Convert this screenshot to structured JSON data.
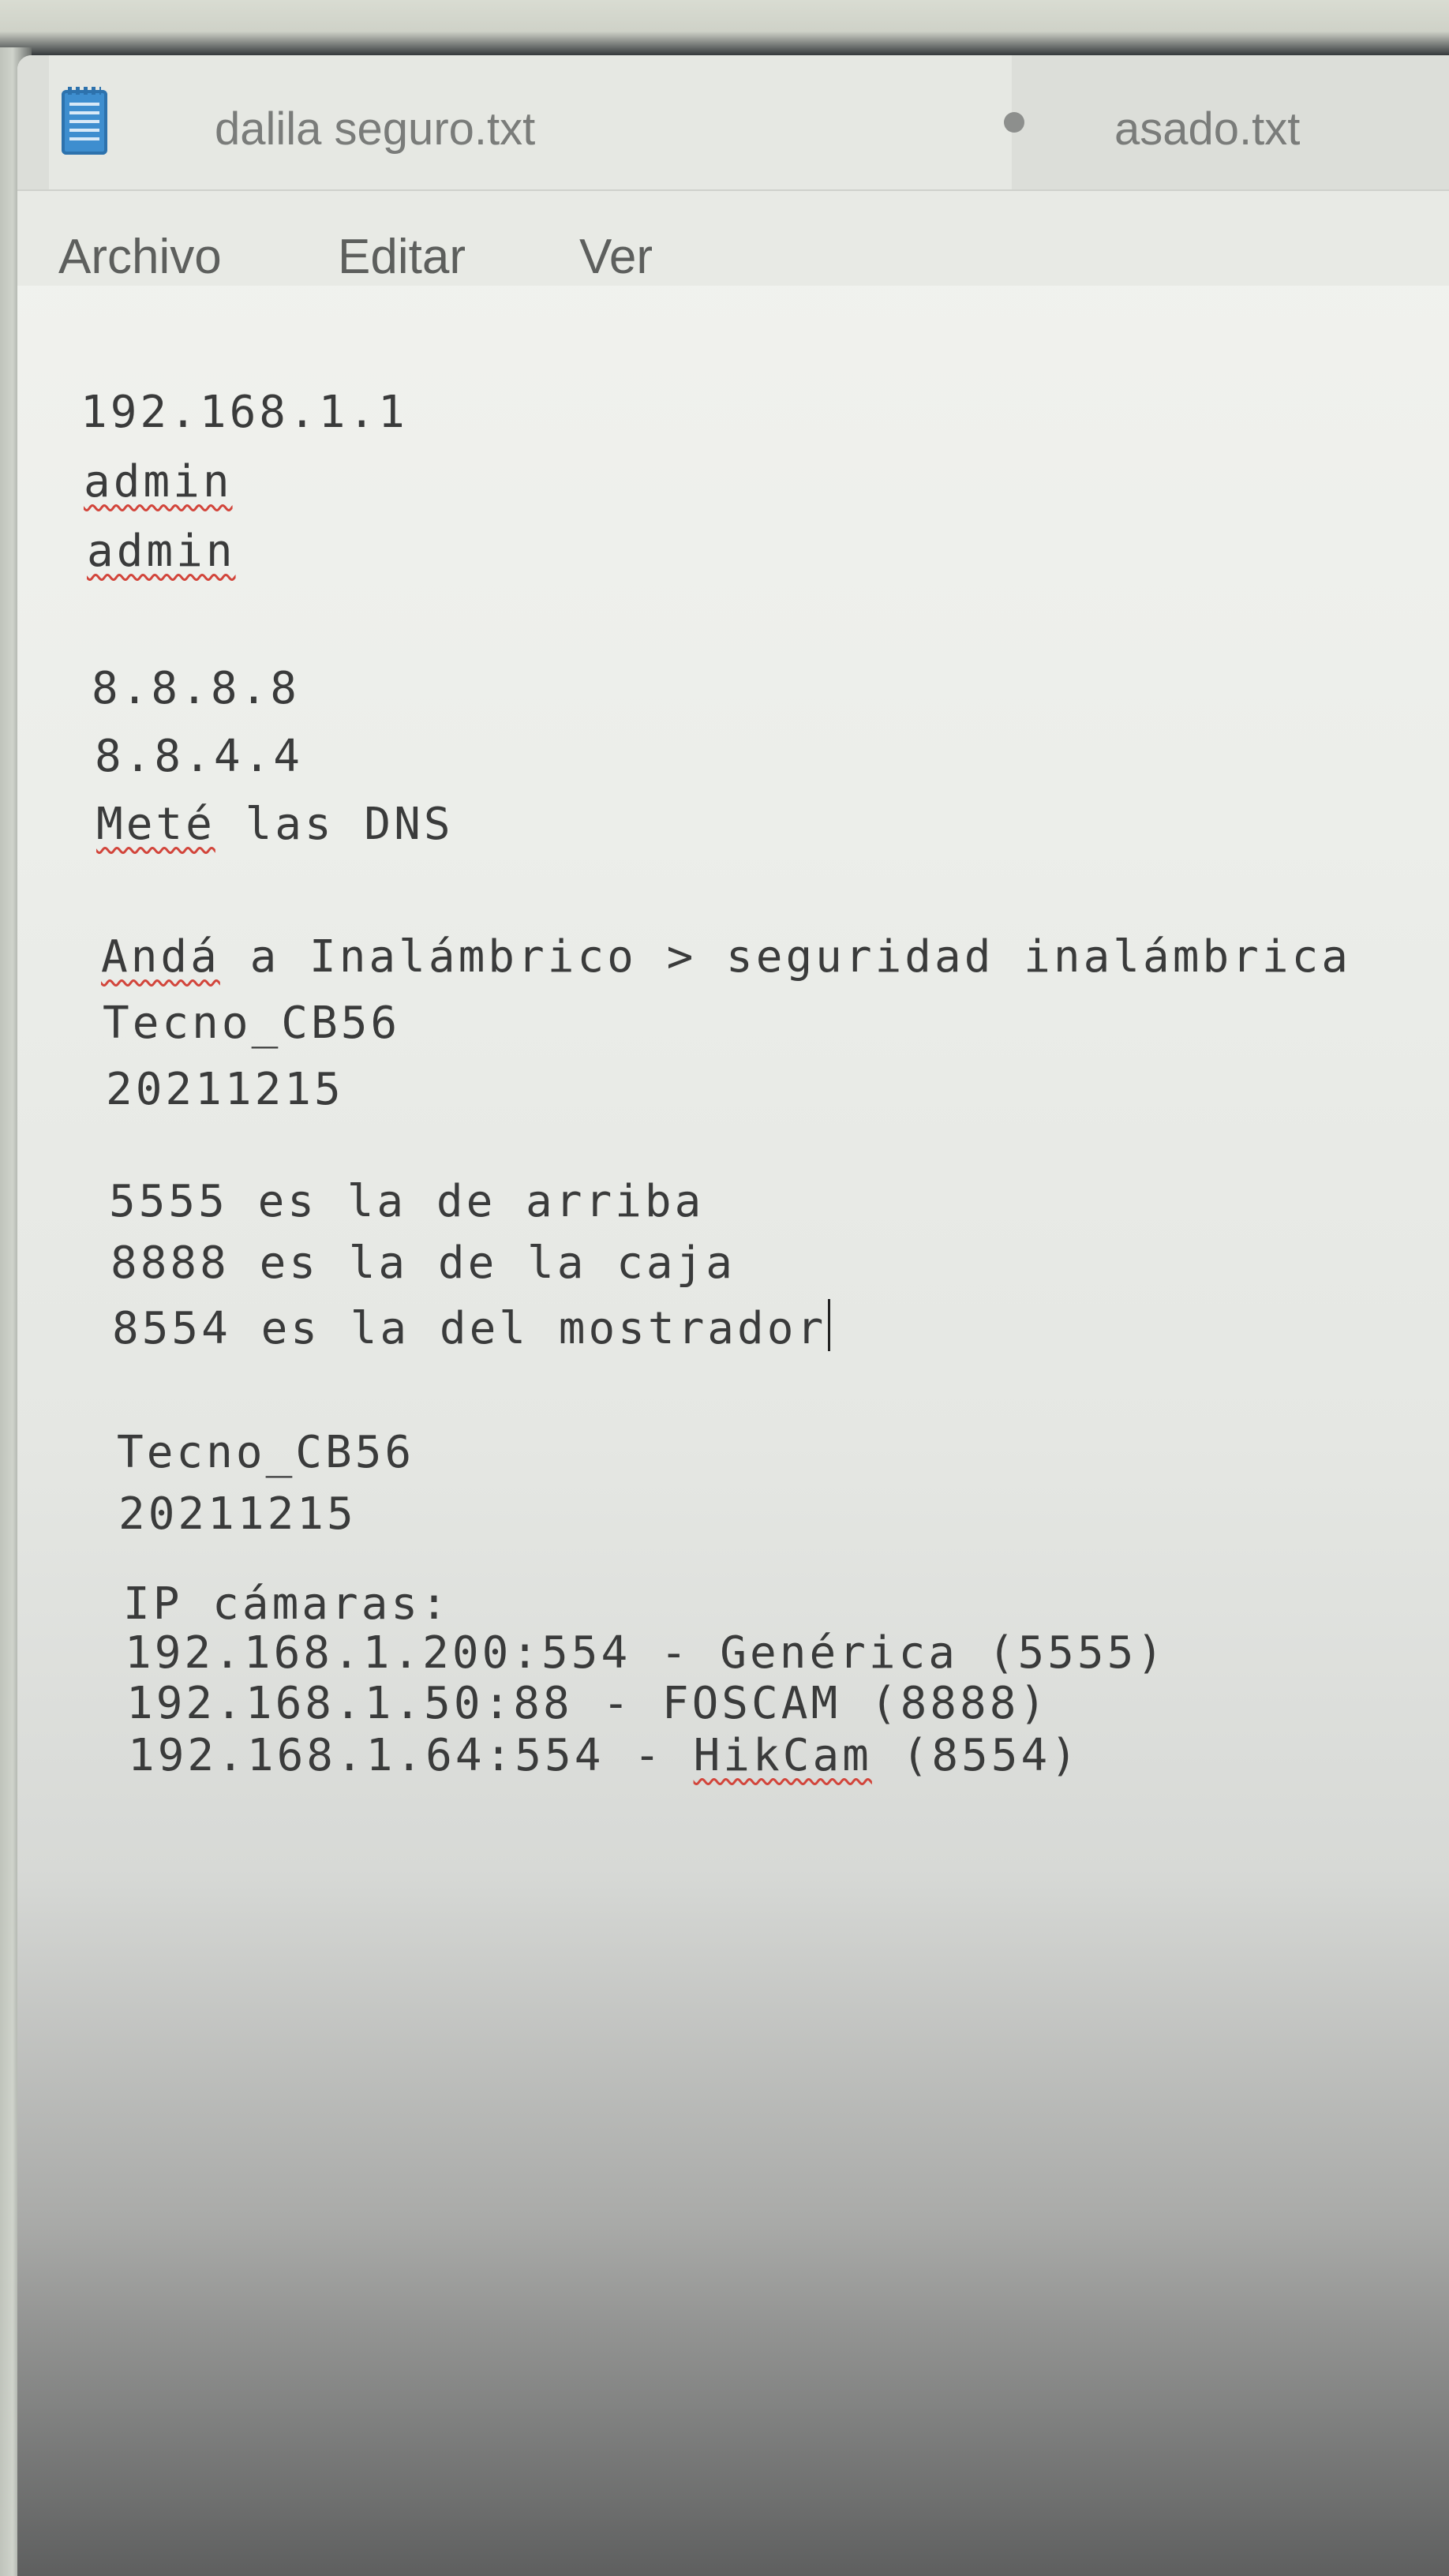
{
  "tabs": [
    {
      "title": "dalila seguro.txt",
      "active": true,
      "unsaved": true
    },
    {
      "title": "asado.txt",
      "active": false
    }
  ],
  "menu": {
    "archivo": "Archivo",
    "editar": "Editar",
    "ver": "Ver"
  },
  "document": {
    "router_ip": "192.168.1.1",
    "user": "admin",
    "pass": "admin",
    "dns1": "8.8.8.8",
    "dns2": "8.8.4.4",
    "dns_pre": "",
    "dns_word": "Meté",
    "dns_rest": " las DNS",
    "wifi_word": "Andá",
    "wifi_rest": " a Inalámbrico > seguridad inalámbrica",
    "ssid_1": "Tecno_CB56",
    "wifi_pass_1": "20211215",
    "port_1": "5555 es la de arriba",
    "port_2": "8888 es la de la caja",
    "port_3": "8554 es la del mostrador",
    "ssid_2": "Tecno_CB56",
    "wifi_pass_2": "20211215",
    "cams_header": "IP cámaras:",
    "cam_1": "192.168.1.200:554 - Genérica (5555)",
    "cam_2": "192.168.1.50:88 - FOSCAM (8888)",
    "cam_3_pre": "192.168.1.64:554 - ",
    "cam_3_word": "HikCam",
    "cam_3_post": " (8554)"
  },
  "colors": {
    "spellcheck": "#d2453b",
    "file_icon": "#3e8ecf"
  },
  "icons": {
    "file": "notepad-file-icon"
  }
}
